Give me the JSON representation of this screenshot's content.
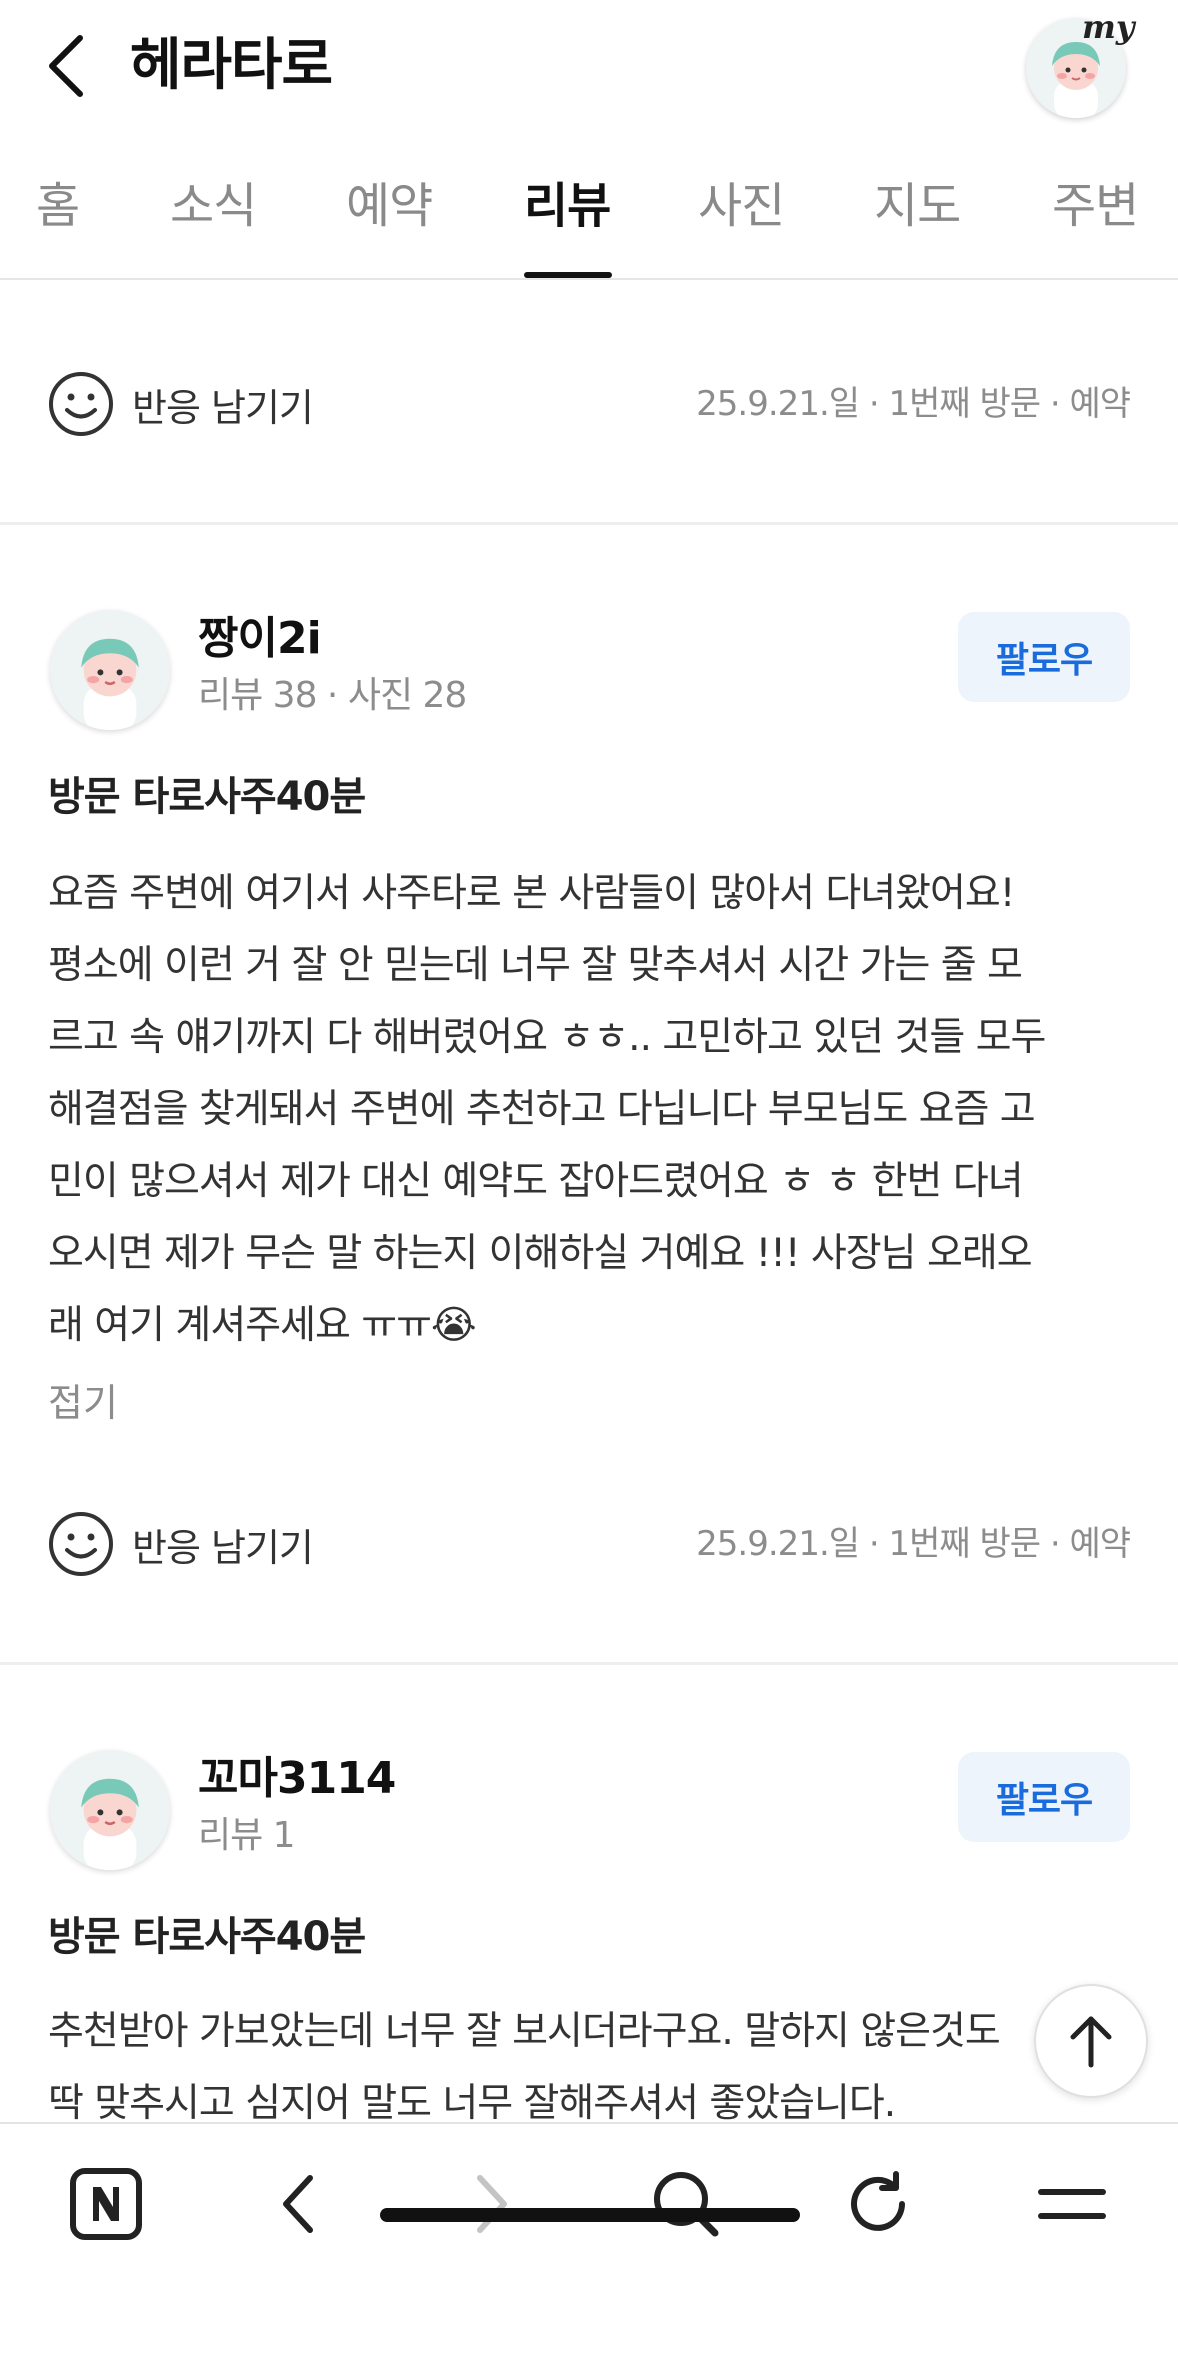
{
  "header": {
    "back_icon": "chevron-left-icon",
    "title": "헤라타로",
    "my_label": "my"
  },
  "tabs": [
    {
      "label": "홈"
    },
    {
      "label": "소식"
    },
    {
      "label": "예약"
    },
    {
      "label": "리뷰",
      "active": true
    },
    {
      "label": "사진"
    },
    {
      "label": "지도"
    },
    {
      "label": "주변"
    }
  ],
  "reviews_top": {
    "react_label": "반응 남기기",
    "meta": "25.9.21.일 · 1번째 방문 · 예약"
  },
  "reviews": [
    {
      "user": "짱이2i",
      "stats": "리뷰 38 · 사진 28",
      "follow_label": "팔로우",
      "visit_title": "방문 타로사주40분",
      "body_lines": [
        "요즘 주변에 여기서 사주타로 본 사람들이 많아서 다녀왔어요!",
        "평소에 이런 거 잘 안 믿는데 너무 잘 맞추셔서 시간 가는 줄 모",
        "르고 속 얘기까지 다 해버렸어요 ㅎㅎ.. 고민하고 있던 것들 모두",
        "해결점을 찾게돼서 주변에 추천하고 다닙니다 부모님도 요즘 고",
        "민이 많으셔서 제가 대신 예약도 잡아드렸어요 ㅎ ㅎ 한번 다녀",
        "오시면 제가 무슨 말 하는지 이해하실 거예요 !!! 사장님 오래오",
        "래 여기 계셔주세요 ㅠㅠ😭"
      ],
      "fold_label": "접기",
      "react_label": "반응 남기기",
      "meta": "25.9.21.일 · 1번째 방문 · 예약"
    },
    {
      "user": "꼬마3114",
      "stats": "리뷰 1",
      "follow_label": "팔로우",
      "visit_title": "방문 타로사주40분",
      "body_lines": [
        "추천받아 가보았는데 너무 잘 보시더라구요. 말하지 않은것도",
        "딱 맞추시고 심지어 말도 너무 잘해주셔서 좋았습니다."
      ]
    }
  ],
  "toolbar": {
    "icons": [
      "naver-home-icon",
      "back-arrow-icon",
      "forward-arrow-icon",
      "search-icon",
      "refresh-icon",
      "menu-icon"
    ]
  },
  "colors": {
    "accent": "#1a6bdc",
    "follow_bg": "#eef4fc",
    "muted_text": "#8c8c8c"
  }
}
